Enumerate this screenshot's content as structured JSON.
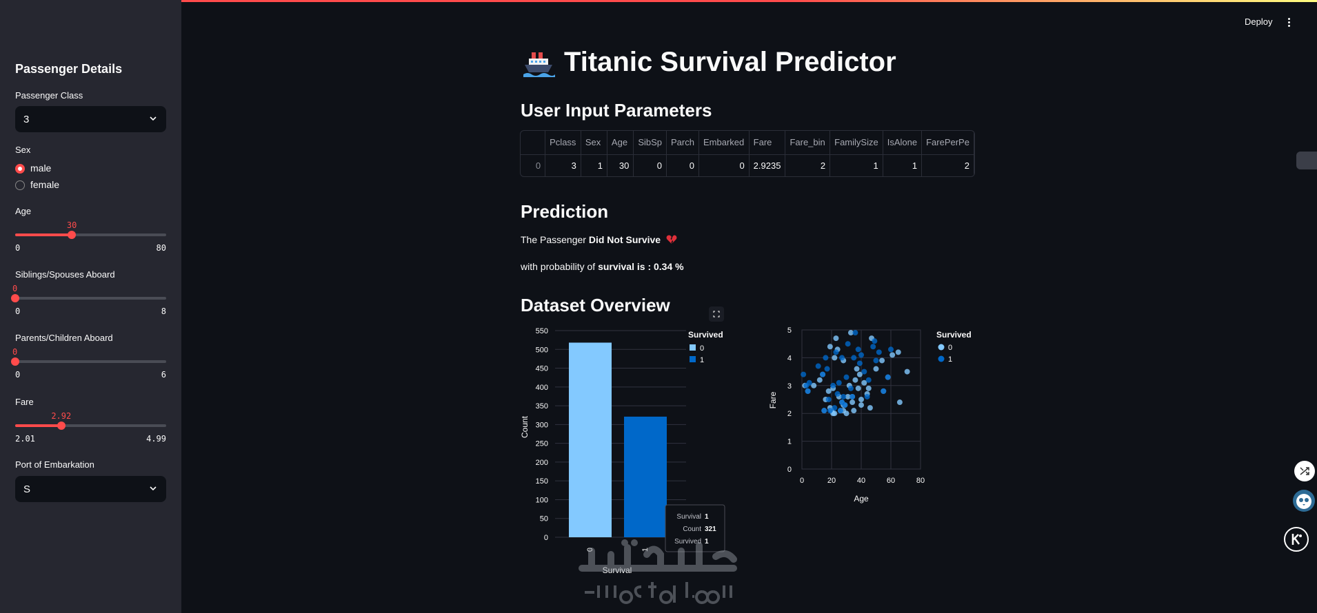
{
  "sidebar": {
    "title": "Passenger Details",
    "pclass": {
      "label": "Passenger Class",
      "value": "3"
    },
    "sex": {
      "label": "Sex",
      "options": [
        "male",
        "female"
      ],
      "selected": "male"
    },
    "age": {
      "label": "Age",
      "value": "30",
      "min": "0",
      "max": "80",
      "fraction": 0.375
    },
    "sibsp": {
      "label": "Siblings/Spouses Aboard",
      "value": "0",
      "min": "0",
      "max": "8",
      "fraction": 0
    },
    "parch": {
      "label": "Parents/Children Aboard",
      "value": "0",
      "min": "0",
      "max": "6",
      "fraction": 0
    },
    "fare": {
      "label": "Fare",
      "value": "2.92",
      "min": "2.01",
      "max": "4.99",
      "fraction": 0.305
    },
    "embarked": {
      "label": "Port of Embarkation",
      "value": "S"
    }
  },
  "header": {
    "deploy": "Deploy"
  },
  "main": {
    "title": "Titanic Survival Predictor",
    "input_header": "User Input Parameters",
    "table": {
      "columns": [
        "",
        "Pclass",
        "Sex",
        "Age",
        "SibSp",
        "Parch",
        "Embarked",
        "Fare",
        "Fare_bin",
        "FamilySize",
        "IsAlone",
        "FarePerPe"
      ],
      "rows": [
        [
          "0",
          "3",
          "1",
          "30",
          "0",
          "0",
          "0",
          "2.9235",
          "2",
          "1",
          "1",
          "2"
        ]
      ]
    },
    "prediction_header": "Prediction",
    "prediction_prefix": "The Passenger ",
    "prediction_result": "Did Not Survive",
    "prob_prefix": "with probability of ",
    "prob_word": "survival",
    "prob_suffix": " is : 0.34 %",
    "overview_header": "Dataset Overview"
  },
  "chart_data": [
    {
      "type": "bar",
      "categories": [
        "0",
        "1"
      ],
      "values": [
        518,
        321
      ],
      "xlabel": "Survival",
      "ylabel": "Count",
      "ylim": [
        0,
        550
      ],
      "yticks": [
        0,
        50,
        100,
        150,
        200,
        250,
        300,
        350,
        400,
        450,
        500,
        550
      ],
      "legend_title": "Survived",
      "legend": [
        "0",
        "1"
      ],
      "colors": [
        "#83c9ff",
        "#0068c9"
      ],
      "tooltip": {
        "Survival": "1",
        "Count": "321",
        "Survived": "1"
      }
    },
    {
      "type": "scatter",
      "xlabel": "Age",
      "ylabel": "Fare",
      "xlim": [
        0,
        80
      ],
      "ylim": [
        0,
        5
      ],
      "xticks": [
        0,
        20,
        40,
        60,
        80
      ],
      "yticks": [
        0,
        1,
        2,
        3,
        4,
        5
      ],
      "legend_title": "Survived",
      "legend": [
        "0",
        "1"
      ],
      "colors": [
        "#83c9ff",
        "#0068c9"
      ],
      "series": [
        {
          "name": "0",
          "points": [
            [
              22,
              2.0
            ],
            [
              35,
              2.1
            ],
            [
              28,
              2.3
            ],
            [
              40,
              2.5
            ],
            [
              19,
              2.2
            ],
            [
              54,
              3.9
            ],
            [
              2,
              3.0
            ],
            [
              27,
              2.4
            ],
            [
              14,
              3.4
            ],
            [
              4,
              2.8
            ],
            [
              58,
              3.3
            ],
            [
              20,
              2.1
            ],
            [
              39,
              3.4
            ],
            [
              55,
              2.8
            ],
            [
              31,
              2.6
            ],
            [
              34,
              2.6
            ],
            [
              15,
              2.1
            ],
            [
              8,
              3.0
            ],
            [
              38,
              2.9
            ],
            [
              26,
              2.1
            ],
            [
              19,
              4.4
            ],
            [
              40,
              2.3
            ],
            [
              66,
              2.4
            ],
            [
              28,
              3.9
            ],
            [
              42,
              3.1
            ],
            [
              21,
              2.0
            ],
            [
              18,
              2.8
            ],
            [
              45,
              2.9
            ],
            [
              61,
              4.1
            ],
            [
              21,
              2.9
            ],
            [
              37,
              3.6
            ],
            [
              65,
              4.2
            ],
            [
              28,
              2.1
            ],
            [
              46,
              2.2
            ],
            [
              22,
              4.0
            ],
            [
              71,
              3.5
            ],
            [
              23,
              4.7
            ],
            [
              34,
              2.4
            ],
            [
              24,
              4.3
            ],
            [
              29,
              2.3
            ],
            [
              47,
              4.7
            ],
            [
              32,
              3.0
            ],
            [
              30,
              2.0
            ],
            [
              25,
              2.6
            ],
            [
              36,
              3.2
            ],
            [
              50,
              3.6
            ],
            [
              44,
              2.7
            ],
            [
              33,
              4.9
            ],
            [
              16,
              2.5
            ],
            [
              12,
              3.2
            ]
          ]
        },
        {
          "name": "1",
          "points": [
            [
              38,
              4.3
            ],
            [
              26,
              2.1
            ],
            [
              35,
              4.0
            ],
            [
              27,
              2.4
            ],
            [
              14,
              3.4
            ],
            [
              4,
              2.8
            ],
            [
              58,
              3.3
            ],
            [
              55,
              2.8
            ],
            [
              34,
              2.6
            ],
            [
              15,
              2.1
            ],
            [
              28,
              2.6
            ],
            [
              3,
              3.0
            ],
            [
              19,
              2.1
            ],
            [
              49,
              4.6
            ],
            [
              29,
              2.3
            ],
            [
              21,
              3.0
            ],
            [
              5,
              3.1
            ],
            [
              24,
              2.7
            ],
            [
              45,
              3.2
            ],
            [
              40,
              4.1
            ],
            [
              36,
              4.9
            ],
            [
              50,
              3.9
            ],
            [
              17,
              3.6
            ],
            [
              31,
              4.5
            ],
            [
              23,
              4.2
            ],
            [
              42,
              3.5
            ],
            [
              1,
              3.4
            ],
            [
              33,
              2.9
            ],
            [
              27,
              4.0
            ],
            [
              22,
              2.2
            ],
            [
              30,
              3.3
            ],
            [
              48,
              4.4
            ],
            [
              18,
              2.5
            ],
            [
              39,
              3.8
            ],
            [
              52,
              4.2
            ],
            [
              11,
              3.7
            ],
            [
              60,
              4.3
            ],
            [
              44,
              2.6
            ],
            [
              25,
              3.1
            ],
            [
              16,
              4.0
            ]
          ]
        }
      ]
    }
  ]
}
